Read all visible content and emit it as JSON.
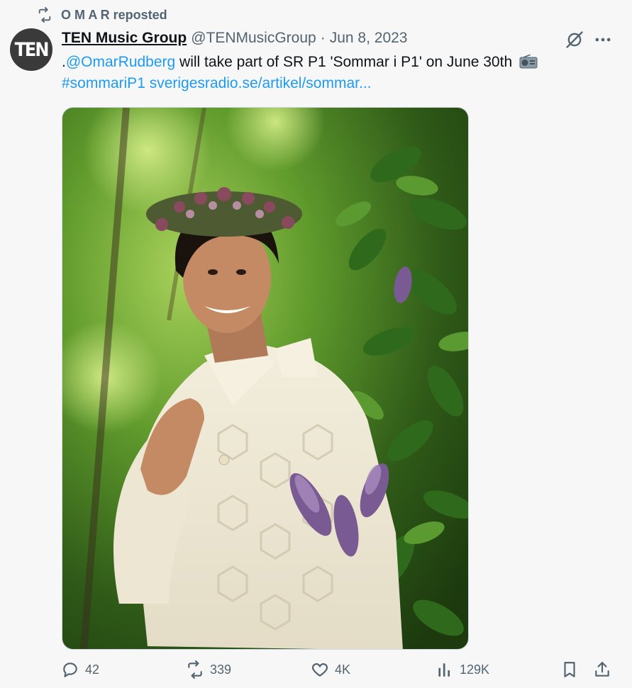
{
  "repost": {
    "label": "O M A R reposted",
    "icon": "repost-icon"
  },
  "author": {
    "avatar_text": "TEN",
    "name": "TEN Music Group",
    "handle": "@TENMusicGroup",
    "separator": "·",
    "date": "Jun 8, 2023"
  },
  "post": {
    "prefix": ".",
    "mention": "@OmarRudberg",
    "body": " will take part of SR P1 'Sommar i P1' on June 30th",
    "emoji": "radio-icon",
    "hashtag": "#sommariP1",
    "link": "sverigesradio.se/artikel/sommar..."
  },
  "actions": {
    "replies": "42",
    "reposts": "339",
    "likes": "4K",
    "views": "129K"
  },
  "colors": {
    "link": "#1d9bf0",
    "muted": "#536471",
    "text": "#0f1419",
    "background": "#f7f7f7"
  }
}
